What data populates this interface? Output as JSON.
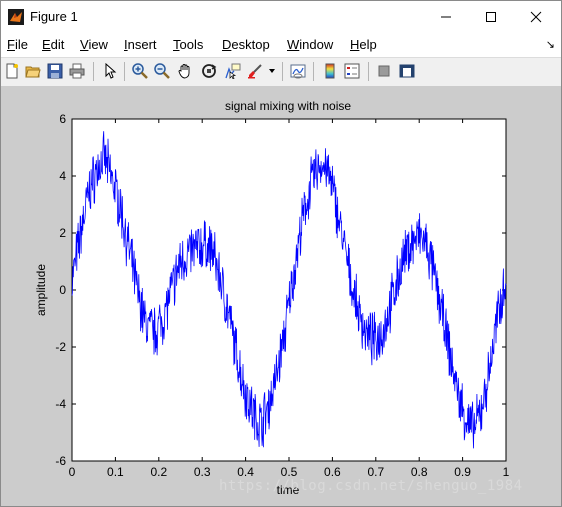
{
  "window": {
    "title": "Figure 1",
    "accent_color": "#0000ff"
  },
  "menu": {
    "items": [
      "File",
      "Edit",
      "View",
      "Insert",
      "Tools",
      "Desktop",
      "Window",
      "Help"
    ]
  },
  "toolbar": {
    "buttons": [
      "new-figure-icon",
      "open-file-icon",
      "save-icon",
      "print-icon",
      "edit-plot-arrow-icon",
      "zoom-in-icon",
      "zoom-out-icon",
      "pan-hand-icon",
      "rotate-3d-icon",
      "data-cursor-icon",
      "brush-icon",
      "link-plot-icon",
      "colorbar-icon",
      "legend-icon",
      "hide-plot-tools-icon",
      "show-plot-tools-icon"
    ]
  },
  "watermark": "https://blog.csdn.net/shenguo_1984",
  "chart_data": {
    "type": "line",
    "title": "signal mixing with noise",
    "xlabel": "time",
    "ylabel": "amplitude",
    "xlim": [
      0,
      1
    ],
    "ylim": [
      -6,
      6
    ],
    "xticks": [
      0,
      0.1,
      0.2,
      0.3,
      0.4,
      0.5,
      0.6,
      0.7,
      0.8,
      0.9,
      1
    ],
    "xtick_labels": [
      "0",
      "0.1",
      "0.2",
      "0.3",
      "0.4",
      "0.5",
      "0.6",
      "0.7",
      "0.8",
      "0.9",
      "1"
    ],
    "yticks": [
      -6,
      -4,
      -2,
      0,
      2,
      4,
      6
    ],
    "ytick_labels": [
      "-6",
      "-4",
      "-2",
      "0",
      "2",
      "4",
      "6"
    ],
    "grid": false,
    "series": [
      {
        "color": "#0000ff",
        "x": [
          0,
          0.02,
          0.04,
          0.06,
          0.075,
          0.09,
          0.11,
          0.13,
          0.15,
          0.17,
          0.19,
          0.21,
          0.23,
          0.25,
          0.27,
          0.29,
          0.31,
          0.325,
          0.34,
          0.36,
          0.38,
          0.4,
          0.42,
          0.435,
          0.45,
          0.47,
          0.49,
          0.51,
          0.53,
          0.55,
          0.57,
          0.585,
          0.6,
          0.62,
          0.64,
          0.66,
          0.68,
          0.7,
          0.72,
          0.74,
          0.76,
          0.78,
          0.8,
          0.815,
          0.83,
          0.85,
          0.87,
          0.89,
          0.91,
          0.925,
          0.94,
          0.96,
          0.98,
          1.0
        ],
        "y": [
          0.3,
          2.0,
          3.5,
          4.3,
          4.6,
          4.0,
          3.0,
          1.5,
          0.0,
          -1.2,
          -1.5,
          -1.0,
          0.0,
          1.0,
          1.3,
          1.5,
          1.6,
          1.3,
          0.5,
          -0.8,
          -2.3,
          -3.6,
          -4.4,
          -4.7,
          -4.2,
          -3.1,
          -1.5,
          0.5,
          2.3,
          3.7,
          4.4,
          4.3,
          3.6,
          2.1,
          0.5,
          -0.8,
          -1.6,
          -1.8,
          -1.3,
          -0.2,
          0.9,
          1.6,
          1.9,
          1.6,
          0.8,
          -0.6,
          -2.2,
          -3.7,
          -4.6,
          -4.9,
          -4.4,
          -3.0,
          -1.0,
          0.5
        ]
      }
    ]
  }
}
